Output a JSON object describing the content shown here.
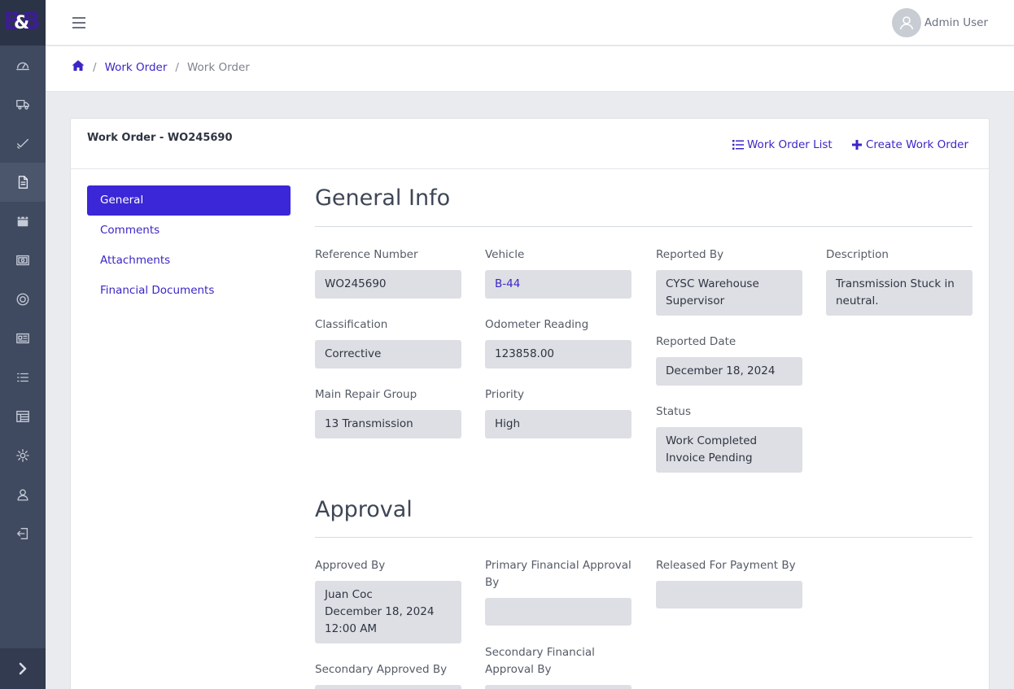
{
  "app": {
    "logo_left": "B",
    "logo_right": "B",
    "logo_amp": "&"
  },
  "sidebar": {
    "items": [
      {
        "icon": "dashboard-icon"
      },
      {
        "icon": "truck-icon"
      },
      {
        "icon": "check-icon"
      },
      {
        "icon": "document-icon",
        "active": true
      },
      {
        "icon": "calendar-icon"
      },
      {
        "icon": "money-icon"
      },
      {
        "icon": "tire-icon"
      },
      {
        "icon": "newspaper-icon"
      },
      {
        "icon": "list-icon"
      },
      {
        "icon": "table-icon"
      },
      {
        "icon": "gear-icon"
      },
      {
        "icon": "user-icon"
      },
      {
        "icon": "logout-icon"
      }
    ]
  },
  "topbar": {
    "user_name": "Admin User"
  },
  "breadcrumb": {
    "link": "Work Order",
    "current": "Work Order"
  },
  "card": {
    "title": "Work Order - WO245690",
    "list_button": "Work Order List",
    "create_button": "Create Work Order"
  },
  "tabs": [
    {
      "label": "General",
      "active": true
    },
    {
      "label": "Comments"
    },
    {
      "label": "Attachments"
    },
    {
      "label": "Financial Documents"
    }
  ],
  "general": {
    "title": "General Info",
    "reference_number": {
      "label": "Reference Number",
      "value": "WO245690"
    },
    "classification": {
      "label": "Classification",
      "value": "Corrective"
    },
    "main_repair_group": {
      "label": "Main Repair Group",
      "value": "13 Transmission"
    },
    "vehicle": {
      "label": "Vehicle",
      "value": "B-44"
    },
    "odometer": {
      "label": "Odometer Reading",
      "value": "123858.00"
    },
    "priority": {
      "label": "Priority",
      "value": "High"
    },
    "reported_by": {
      "label": "Reported By",
      "value": "CYSC Warehouse Supervisor"
    },
    "reported_date": {
      "label": "Reported Date",
      "value": "December 18, 2024"
    },
    "status": {
      "label": "Status",
      "value": "Work Completed Invoice Pending"
    },
    "description": {
      "label": "Description",
      "value": "Transmission Stuck in neutral."
    }
  },
  "approval": {
    "title": "Approval",
    "approved_by": {
      "label": "Approved By",
      "value_name": "Juan Coc",
      "value_date": "December 18, 2024",
      "value_time": "12:00 AM"
    },
    "primary_financial": {
      "label_line1": "Primary Financial Approval",
      "label_line2": "By",
      "value": ""
    },
    "released_for_payment": {
      "label": "Released For Payment By",
      "value": ""
    },
    "secondary_approved_by": {
      "label": "Secondary Approved By",
      "value": ""
    },
    "secondary_financial": {
      "label_line1": "Secondary Financial",
      "label_line2": "Approval By",
      "value": ""
    }
  },
  "colors": {
    "accent": "#3b26d8",
    "sidebar": "#3f4a60",
    "field_bg": "#dddfe4"
  }
}
